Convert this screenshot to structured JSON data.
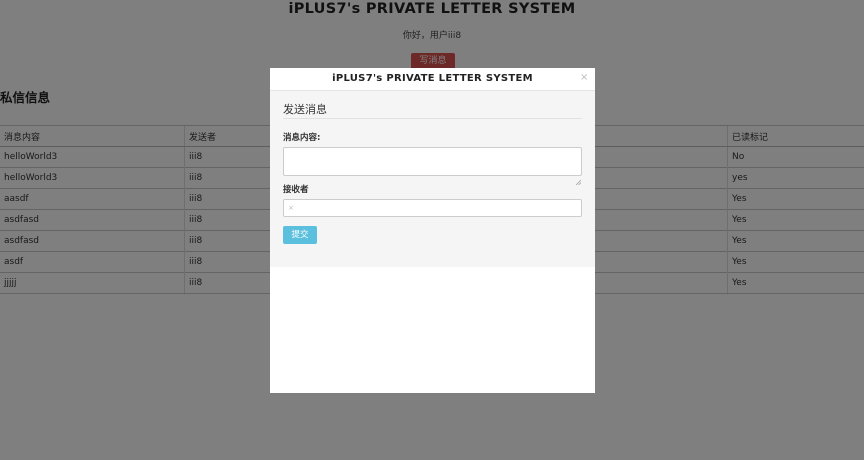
{
  "header": {
    "title": "iPLUS7's PRIVATE LETTER SYSTEM",
    "greeting": "你好，用户iii8",
    "write_button": "写消息"
  },
  "section": {
    "title": "私信信息"
  },
  "table": {
    "columns": [
      "消息内容",
      "发送者",
      "已读标记"
    ],
    "rows": [
      {
        "content": "helloWorld3",
        "sender": "iii8",
        "read": "No"
      },
      {
        "content": "helloWorld3",
        "sender": "iii8",
        "read": "yes"
      },
      {
        "content": "aasdf",
        "sender": "iii8",
        "read": "Yes"
      },
      {
        "content": "asdfasd",
        "sender": "iii8",
        "read": "Yes"
      },
      {
        "content": "asdfasd",
        "sender": "iii8",
        "read": "Yes"
      },
      {
        "content": "asdf",
        "sender": "iii8",
        "read": "Yes"
      },
      {
        "content": "jjjjj",
        "sender": "iii8",
        "read": "Yes"
      }
    ]
  },
  "modal": {
    "title": "iPLUS7's PRIVATE LETTER SYSTEM",
    "close": "×",
    "form_heading": "发送消息",
    "content_label": "消息内容:",
    "content_value": "",
    "receiver_label": "接收者",
    "receiver_value": "",
    "receiver_hint": "×",
    "submit_label": "提交"
  },
  "colors": {
    "write_button": "#d9534f",
    "submit_button": "#5bc0de"
  }
}
